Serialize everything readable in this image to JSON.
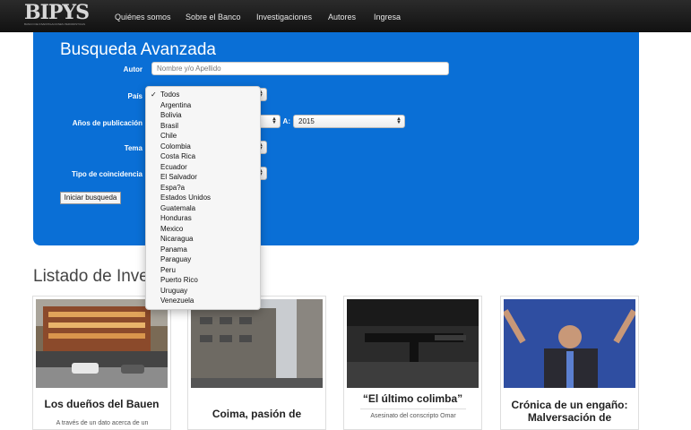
{
  "brand": {
    "logo_text": "BIPYS",
    "logo_sub": "BANCO DE INVESTIGACIONES PERIODISTICAS"
  },
  "nav": {
    "items": [
      "Quiénes somos",
      "Sobre el Banco",
      "Investigaciones",
      "Autores",
      "Ingresa"
    ]
  },
  "search": {
    "title": "Busqueda Avanzada",
    "author_label": "Autor",
    "author_placeholder": "Nombre y/o Apellido",
    "country_label": "País",
    "years_label": "Años de publicación",
    "years_to_label": "A:",
    "year_to_value": "2015",
    "topic_label": "Tema",
    "match_label": "Tipo de coincidencia",
    "submit_label": "Iniciar busqueda"
  },
  "country_dropdown": {
    "selected": "Todos",
    "options": [
      "Todos",
      "Argentina",
      "Bolivia",
      "Brasil",
      "Chile",
      "Colombia",
      "Costa Rica",
      "Ecuador",
      "El Salvador",
      "Espa?a",
      "Estados Unidos",
      "Guatemala",
      "Honduras",
      "Mexico",
      "Nicaragua",
      "Panama",
      "Paraguay",
      "Peru",
      "Puerto Rico",
      "Uruguay",
      "Venezuela"
    ]
  },
  "list": {
    "title": "Listado de Investigaciones",
    "cards": [
      {
        "title": "Los dueños del Bauen",
        "desc": "A través de un dato acerca de un"
      },
      {
        "title": "Coima, pasión de",
        "desc": ""
      },
      {
        "title": "“El último colimba”",
        "desc": "Asesinato del conscripto Omar"
      },
      {
        "title": "Crónica de un engaño: Malversación de",
        "desc": ""
      }
    ]
  },
  "colors": {
    "panel_blue": "#0a6fd6",
    "navbar": "#1b1b1b"
  }
}
